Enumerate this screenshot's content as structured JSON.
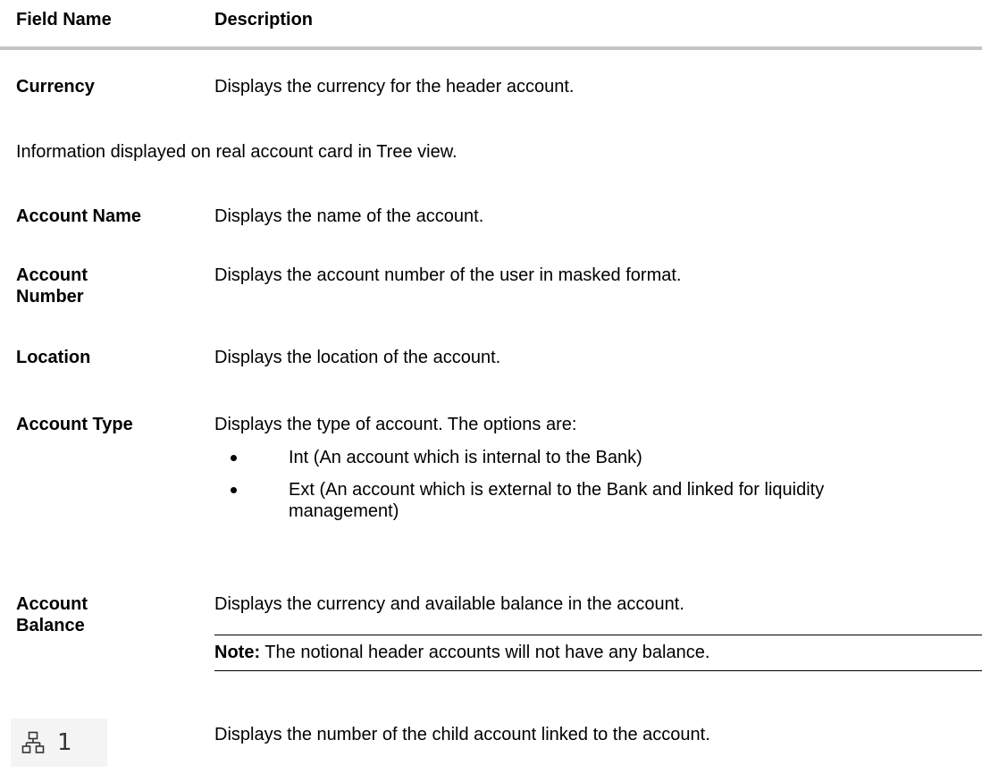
{
  "header": {
    "field_name": "Field Name",
    "description": "Description"
  },
  "currency": {
    "label": "Currency",
    "desc": "Displays the currency for the header account."
  },
  "section_note": "Information displayed on real account card in Tree view.",
  "fields": {
    "account_name": {
      "label": "Account Name",
      "desc": "Displays the name of the account."
    },
    "account_number": {
      "label_line1": "Account",
      "label_line2": "Number",
      "desc": "Displays the account number of the user in masked format."
    },
    "location": {
      "label": "Location",
      "desc": "Displays the location of the account."
    },
    "account_type": {
      "label": "Account Type",
      "desc": "Displays the type of account. The options are:",
      "options": [
        "Int (An account which is internal to the Bank)",
        "Ext (An account which is external to the Bank and linked for liquidity management)"
      ]
    },
    "account_balance": {
      "label_line1": "Account",
      "label_line2": "Balance",
      "desc": "Displays the currency and available balance in the account.",
      "note_label": "Note:",
      "note_text": " The notional header accounts will not have any balance."
    },
    "child_accounts": {
      "count": "1",
      "desc": "Displays the number of the child account linked to the account.",
      "icon": "hierarchy-icon"
    }
  }
}
